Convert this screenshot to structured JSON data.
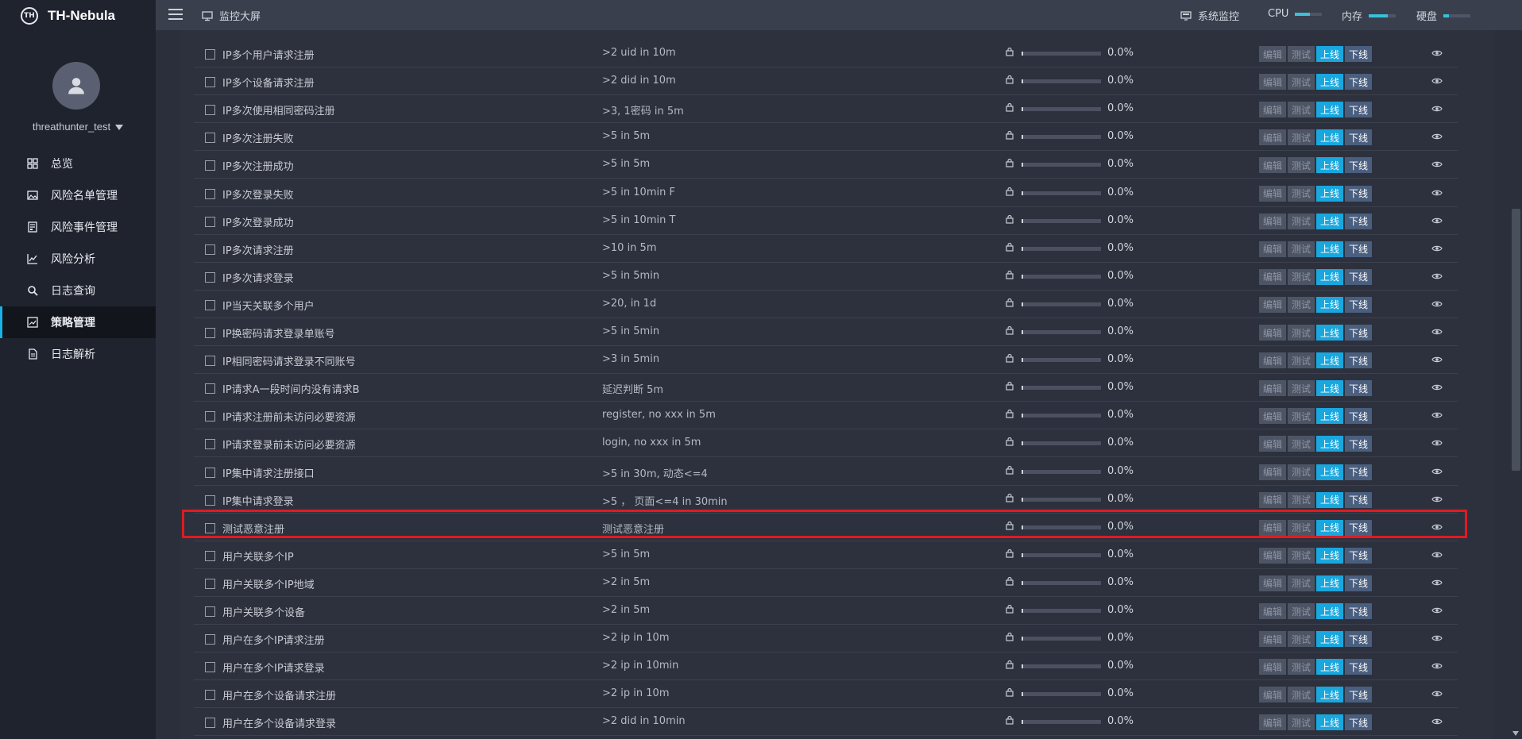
{
  "brand": {
    "name": "TH-Nebula",
    "logo_text": "TH"
  },
  "user": {
    "name": "threathunter_test"
  },
  "menu": [
    {
      "label": "总览",
      "icon": "grid-icon",
      "active": false
    },
    {
      "label": "风险名单管理",
      "icon": "image-list-icon",
      "active": false
    },
    {
      "label": "风险事件管理",
      "icon": "document-icon",
      "active": false
    },
    {
      "label": "风险分析",
      "icon": "line-chart-icon",
      "active": false
    },
    {
      "label": "日志查询",
      "icon": "search-icon",
      "active": false
    },
    {
      "label": "策略管理",
      "icon": "strategy-icon",
      "active": true
    },
    {
      "label": "日志解析",
      "icon": "file-icon",
      "active": false
    }
  ],
  "topbar": {
    "screen_label": "监控大屏",
    "system_label": "系统监控",
    "meters": [
      {
        "label": "CPU",
        "fraction": 0.55
      },
      {
        "label": "内存",
        "fraction": 0.7
      },
      {
        "label": "硬盘",
        "fraction": 0.2
      }
    ]
  },
  "buttons": {
    "edit": "编辑",
    "test": "测试",
    "online": "上线",
    "offline": "下线"
  },
  "colors": {
    "accent": "#19b2e8",
    "highlight": "#e01a22"
  },
  "rows": [
    {
      "name": "IP多个用户请求注册",
      "condition": ">2 uid in 10m",
      "percent": "0.0%"
    },
    {
      "name": "IP多个设备请求注册",
      "condition": ">2 did in 10m",
      "percent": "0.0%"
    },
    {
      "name": "IP多次使用相同密码注册",
      "condition": ">3, 1密码 in 5m",
      "percent": "0.0%"
    },
    {
      "name": "IP多次注册失败",
      "condition": ">5 in 5m",
      "percent": "0.0%"
    },
    {
      "name": "IP多次注册成功",
      "condition": ">5 in 5m",
      "percent": "0.0%"
    },
    {
      "name": "IP多次登录失败",
      "condition": ">5 in 10min F",
      "percent": "0.0%"
    },
    {
      "name": "IP多次登录成功",
      "condition": ">5 in 10min T",
      "percent": "0.0%"
    },
    {
      "name": "IP多次请求注册",
      "condition": ">10 in 5m",
      "percent": "0.0%"
    },
    {
      "name": "IP多次请求登录",
      "condition": ">5 in 5min",
      "percent": "0.0%"
    },
    {
      "name": "IP当天关联多个用户",
      "condition": ">20, in 1d",
      "percent": "0.0%"
    },
    {
      "name": "IP换密码请求登录单账号",
      "condition": ">5 in 5min",
      "percent": "0.0%"
    },
    {
      "name": "IP相同密码请求登录不同账号",
      "condition": ">3 in 5min",
      "percent": "0.0%"
    },
    {
      "name": "IP请求A一段时间内没有请求B",
      "condition": "延迟判断 5m",
      "percent": "0.0%"
    },
    {
      "name": "IP请求注册前未访问必要资源",
      "condition": "register, no xxx in 5m",
      "percent": "0.0%"
    },
    {
      "name": "IP请求登录前未访问必要资源",
      "condition": "login, no xxx in 5m",
      "percent": "0.0%"
    },
    {
      "name": "IP集中请求注册接口",
      "condition": ">5 in 30m, 动态<=4",
      "percent": "0.0%"
    },
    {
      "name": "IP集中请求登录",
      "condition": ">5 ， 页面<=4 in 30min",
      "percent": "0.0%"
    },
    {
      "name": "测试恶意注册",
      "condition": "测试恶意注册",
      "percent": "0.0%"
    },
    {
      "name": "用户关联多个IP",
      "condition": ">5 in 5m",
      "percent": "0.0%"
    },
    {
      "name": "用户关联多个IP地域",
      "condition": ">2 in 5m",
      "percent": "0.0%"
    },
    {
      "name": "用户关联多个设备",
      "condition": ">2 in 5m",
      "percent": "0.0%"
    },
    {
      "name": "用户在多个IP请求注册",
      "condition": ">2 ip in 10m",
      "percent": "0.0%"
    },
    {
      "name": "用户在多个IP请求登录",
      "condition": ">2 ip in 10min",
      "percent": "0.0%"
    },
    {
      "name": "用户在多个设备请求注册",
      "condition": ">2 ip in 10m",
      "percent": "0.0%"
    },
    {
      "name": "用户在多个设备请求登录",
      "condition": ">2 did in 10min",
      "percent": "0.0%"
    }
  ]
}
